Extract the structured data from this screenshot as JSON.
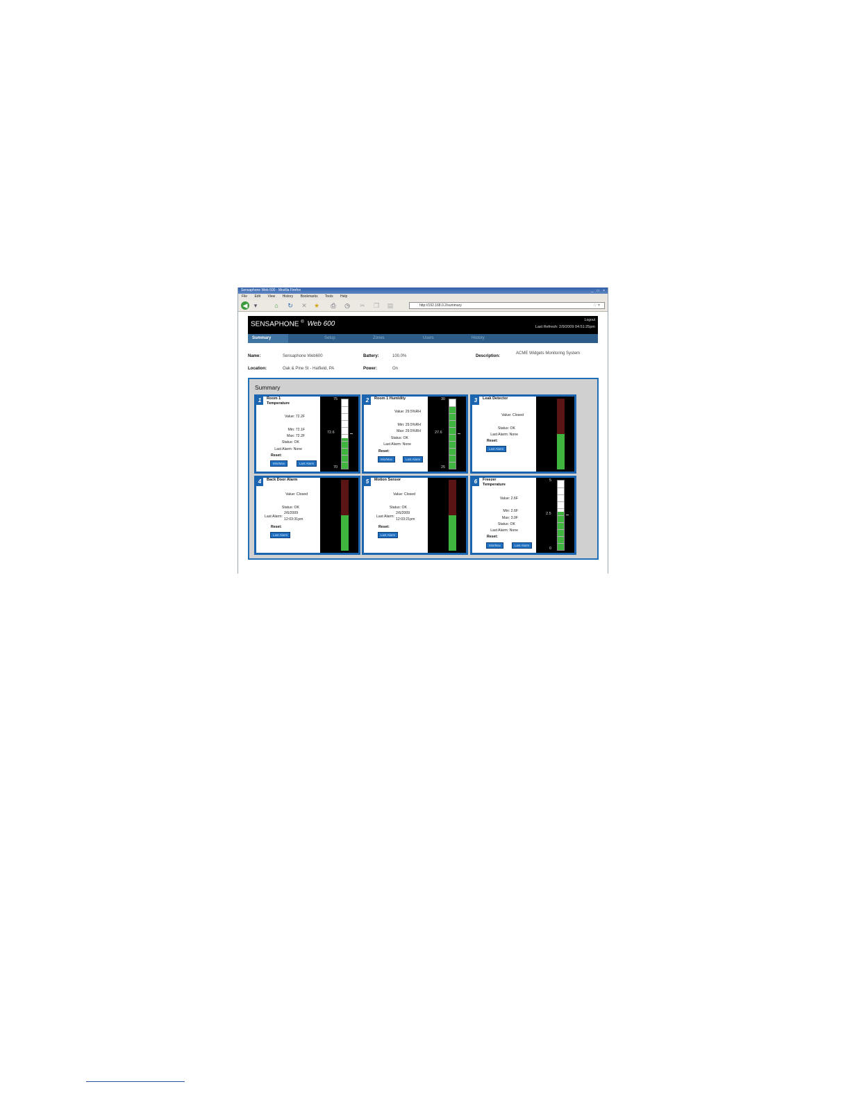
{
  "window": {
    "title": "Sensaphone Web 600 - Mozilla Firefox",
    "controls": "_ □ ×"
  },
  "menu": [
    "File",
    "Edit",
    "View",
    "History",
    "Bookmarks",
    "Tools",
    "Help"
  ],
  "toolbar": {
    "url": "http://192.168.0.2/summary",
    "icons": [
      "back-icon",
      "history-dropdown-icon",
      "home-icon",
      "reload-icon",
      "stop-icon",
      "bookmark-icon",
      "print-icon",
      "clock-icon",
      "cut-icon",
      "copy-icon",
      "paste-icon"
    ]
  },
  "header": {
    "brand": "SENSAPHONE",
    "reg": "®",
    "product": "Web 600",
    "logout": "Logout",
    "last_refresh": "Last Refresh: 2/9/2009 04:51:25pm"
  },
  "nav": {
    "tabs": [
      "Summary",
      "Setup",
      "Zones",
      "Users",
      "History"
    ],
    "active": "Summary"
  },
  "device": {
    "name_label": "Name:",
    "name_value": "Sensaphone Web600",
    "location_label": "Location:",
    "location_value": "Oak & Pine St - Hatfield, PA",
    "battery_label": "Battery:",
    "battery_value": "100.0%",
    "power_label": "Power:",
    "power_value": "On",
    "description_label": "Description:",
    "description_value": "ACME Widgets Monitoring System"
  },
  "summary": {
    "title": "Summary",
    "zones": [
      {
        "number": "1",
        "name": "Room 1 Temperature",
        "value": "Value: 72.2F",
        "min": "Min: 72.1F",
        "max": "Max: 72.2F",
        "status": "Status: OK",
        "last_alarm": "Last Alarm: None",
        "reset_label": "Reset:",
        "btn_minmax": "Min/Max",
        "btn_lastalarm": "Last Alarm",
        "gauge": {
          "top": "75",
          "mid": "72.6",
          "bottom": "70",
          "level": 0.44
        }
      },
      {
        "number": "2",
        "name": "Room 1 Humidity",
        "value": "Value: 29.5%RH",
        "min": "Min: 29.5%RH",
        "max": "Max: 29.5%RH",
        "status": "Status: OK",
        "last_alarm": "Last Alarm: None",
        "reset_label": "Reset:",
        "btn_minmax": "Min/Max",
        "btn_lastalarm": "Last Alarm",
        "gauge": {
          "top": "30",
          "mid": "27.6",
          "bottom": "25",
          "level": 0.9
        }
      },
      {
        "number": "3",
        "name": "Leak Detector",
        "value": "Value: Closed",
        "status": "Status: OK",
        "last_alarm": "Last Alarm: None",
        "reset_label": "Reset:",
        "btn_lastalarm": "Last Alarm",
        "gauge": {
          "level": 0.5
        }
      },
      {
        "number": "4",
        "name": "Back Door Alarm",
        "value": "Value: Closed",
        "status": "Status: OK",
        "last_alarm_label": "Last Alarm:",
        "last_alarm_date": "2/6/2009",
        "last_alarm_time": "12:03:31pm",
        "reset_label": "Reset:",
        "btn_lastalarm": "Last Alarm",
        "gauge": {
          "level": 0.5
        }
      },
      {
        "number": "5",
        "name": "Motion Sensor",
        "value": "Value: Closed",
        "status": "Status: OK",
        "last_alarm_label": "Last Alarm:",
        "last_alarm_date": "2/6/2009",
        "last_alarm_time": "12:03:21pm",
        "reset_label": "Reset:",
        "btn_lastalarm": "Last Alarm",
        "gauge": {
          "level": 0.5
        }
      },
      {
        "number": "6",
        "name": "Freezer Temperature",
        "value": "Value: 2.6F",
        "min": "Min: 2.6F",
        "max": "Max: 3.0F",
        "status": "Status: OK",
        "last_alarm": "Last Alarm: None",
        "reset_label": "Reset:",
        "btn_minmax": "Min/Max",
        "btn_lastalarm": "Last Alarm",
        "gauge": {
          "top": "5",
          "mid": "2.5",
          "bottom": "0",
          "level": 0.55
        }
      }
    ]
  }
}
